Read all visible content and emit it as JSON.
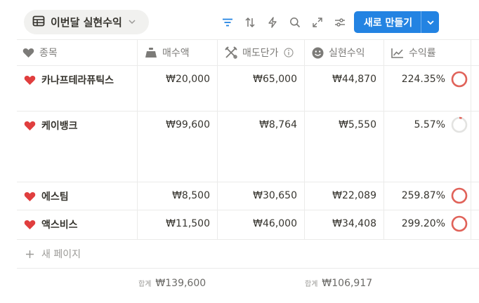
{
  "view": {
    "label": "이번달 실현수익"
  },
  "new_button": {
    "label": "새로 만들기"
  },
  "columns": [
    {
      "label": "종목",
      "icon": "heart-icon"
    },
    {
      "label": "매수액",
      "icon": "weight-icon"
    },
    {
      "label": "매도단가",
      "icon": "crossed-tools-icon"
    },
    {
      "label": "실현수익",
      "icon": "smile-icon"
    },
    {
      "label": "수익률",
      "icon": "trend-chart-icon"
    }
  ],
  "rows": [
    {
      "name": "카나프테라퓨틱스",
      "buy": "₩20,000",
      "sell": "₩65,000",
      "profit": "₩44,870",
      "rate": "224.35%",
      "progress": 1.0
    },
    {
      "name": "케이뱅크",
      "buy": "₩99,600",
      "sell": "₩8,764",
      "profit": "₩5,550",
      "rate": "5.57%",
      "progress": 0.0557
    },
    {
      "name": "에스팀",
      "buy": "₩8,500",
      "sell": "₩30,650",
      "profit": "₩22,089",
      "rate": "259.87%",
      "progress": 1.0
    },
    {
      "name": "액스비스",
      "buy": "₩11,500",
      "sell": "₩46,000",
      "profit": "₩34,408",
      "rate": "299.20%",
      "progress": 1.0
    }
  ],
  "add_row": {
    "label": "새 페이지"
  },
  "sums": {
    "buy": {
      "label": "합계",
      "value": "₩139,600"
    },
    "profit": {
      "label": "합계",
      "value": "₩106,917"
    }
  },
  "colors": {
    "accent": "#2383e2",
    "heart": "#e03e3e",
    "ring": "#e16259",
    "ring_track": "#e3e3e1"
  }
}
